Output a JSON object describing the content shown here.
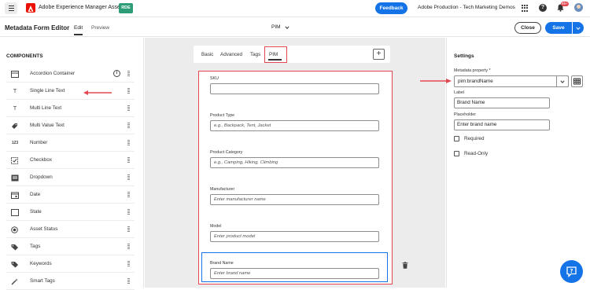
{
  "topbar": {
    "app_title": "Adobe Experience Manager Assets",
    "badge": "RDE",
    "feedback_label": "Feedback",
    "environment": "Adobe Production - Tech Marketing Demos",
    "notification_count": "99+"
  },
  "editor": {
    "title": "Metadata Form Editor",
    "tabs": [
      "Edit",
      "Preview"
    ],
    "active_tab": "Edit",
    "form_name": "PIM",
    "close_label": "Close",
    "save_label": "Save"
  },
  "components": {
    "title": "COMPONENTS",
    "items": [
      {
        "label": "Accordion Container",
        "icon": "accordion-icon"
      },
      {
        "label": "Single Line Text",
        "icon": "text-icon"
      },
      {
        "label": "Multi Line Text",
        "icon": "text-icon"
      },
      {
        "label": "Multi Value Text",
        "icon": "tag-multi-icon"
      },
      {
        "label": "Number",
        "icon": "number-icon"
      },
      {
        "label": "Checkbox",
        "icon": "checkbox-icon"
      },
      {
        "label": "Dropdown",
        "icon": "dropdown-icon"
      },
      {
        "label": "Date",
        "icon": "calendar-icon"
      },
      {
        "label": "State",
        "icon": "state-icon"
      },
      {
        "label": "Asset Status",
        "icon": "status-icon"
      },
      {
        "label": "Tags",
        "icon": "tag-icon"
      },
      {
        "label": "Keywords",
        "icon": "keyword-icon"
      },
      {
        "label": "Smart Tags",
        "icon": "smart-tags-icon"
      }
    ]
  },
  "form": {
    "tabs": [
      "Basic",
      "Advanced",
      "Tags",
      "PIM"
    ],
    "active_tab": "PIM",
    "fields": [
      {
        "label": "SKU",
        "placeholder": ""
      },
      {
        "label": "Product Type",
        "placeholder": "e.g., Backpack, Tent, Jacket"
      },
      {
        "label": "Product Category",
        "placeholder": "e.g., Camping, Hiking, Climbing"
      },
      {
        "label": "Manufacturer",
        "placeholder": "Enter manufacturer name"
      },
      {
        "label": "Model",
        "placeholder": "Enter product model"
      },
      {
        "label": "Brand Name",
        "placeholder": "Enter brand name"
      }
    ]
  },
  "settings": {
    "title": "Settings",
    "metadata_property_label": "Metadata property",
    "required_marker": "*",
    "metadata_property_value": "pim:brandName",
    "label_label": "Label",
    "label_value": "Brand Name",
    "placeholder_label": "Placeholder",
    "placeholder_value": "Enter brand name",
    "checkboxes": [
      {
        "label": "Required",
        "checked": false
      },
      {
        "label": "Read-Only",
        "checked": false
      }
    ]
  },
  "colors": {
    "accent": "#1473e6",
    "annotation": "#e34850",
    "badge": "#2d9d78"
  }
}
